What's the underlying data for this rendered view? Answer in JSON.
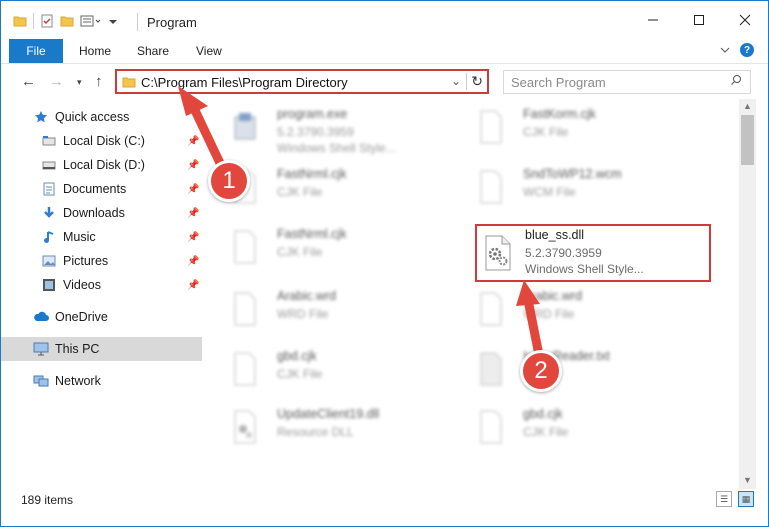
{
  "window": {
    "title": "Program"
  },
  "ribbon": {
    "tabs": [
      "File",
      "Home",
      "Share",
      "View"
    ]
  },
  "navbar": {
    "address": "C:\\Program Files\\Program Directory",
    "search_placeholder": "Search Program"
  },
  "sidebar": {
    "items": [
      {
        "label": "Quick access",
        "icon": "star-icon"
      },
      {
        "label": "Local Disk (C:)",
        "icon": "drive-icon"
      },
      {
        "label": "Local Disk (D:)",
        "icon": "drive-icon"
      },
      {
        "label": "Documents",
        "icon": "document-icon"
      },
      {
        "label": "Downloads",
        "icon": "download-icon"
      },
      {
        "label": "Music",
        "icon": "music-icon"
      },
      {
        "label": "Pictures",
        "icon": "picture-icon"
      },
      {
        "label": "Videos",
        "icon": "video-icon"
      },
      {
        "label": "OneDrive",
        "icon": "cloud-icon"
      },
      {
        "label": "This PC",
        "icon": "computer-icon"
      },
      {
        "label": "Network",
        "icon": "network-icon"
      }
    ]
  },
  "files": [
    {
      "name": "program.exe",
      "sub1": "5.2.3790.3959",
      "sub2": "Windows Shell Style..."
    },
    {
      "name": "FastKorm.cjk",
      "sub1": "CJK File",
      "sub2": ""
    },
    {
      "name": "FastNrml.cjk",
      "sub1": "CJK File",
      "sub2": ""
    },
    {
      "name": "SndToWP12.wcm",
      "sub1": "WCM File",
      "sub2": ""
    },
    {
      "name": "FastNrml.cjk",
      "sub1": "CJK File",
      "sub2": ""
    },
    {
      "name": "blue_ss.dll",
      "sub1": "5.2.3790.3959",
      "sub2": "Windows Shell Style..."
    },
    {
      "name": "Arabic.wrd",
      "sub1": "WRD File",
      "sub2": ""
    },
    {
      "name": "Arabic.wrd",
      "sub1": "WRD File",
      "sub2": ""
    },
    {
      "name": "gbd.cjk",
      "sub1": "CJK File",
      "sub2": ""
    },
    {
      "name": "InlineReader.txt",
      "sub1": "",
      "sub2": ""
    },
    {
      "name": "UpdateClient19.dll",
      "sub1": "Resource DLL",
      "sub2": ""
    },
    {
      "name": "gbd.cjk",
      "sub1": "CJK File",
      "sub2": ""
    }
  ],
  "status": {
    "count": "189 items"
  },
  "callouts": [
    "1",
    "2"
  ],
  "colors": {
    "accent": "#1979ca",
    "highlight": "#d03a3a",
    "callout": "#e2473d"
  }
}
